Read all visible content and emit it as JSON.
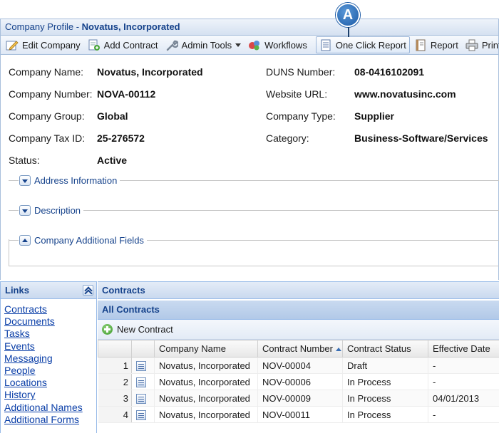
{
  "badge": "A",
  "title": {
    "prefix": "Company Profile - ",
    "company": "Novatus, Incorporated"
  },
  "toolbar": {
    "edit_company": "Edit Company",
    "add_contract": "Add Contract",
    "admin_tools": "Admin Tools",
    "workflows": "Workflows",
    "one_click_report": "One Click Report",
    "report": "Report",
    "print": "Print"
  },
  "profile": {
    "left": [
      {
        "label": "Company Name:",
        "value": "Novatus, Incorporated"
      },
      {
        "label": "Company Number:",
        "value": "NOVA-00112"
      },
      {
        "label": "Company Group:",
        "value": "Global"
      },
      {
        "label": "Company Tax ID:",
        "value": "25-276572"
      },
      {
        "label": "Status:",
        "value": "Active"
      }
    ],
    "right": [
      {
        "label": "DUNS Number:",
        "value": "08-0416102091"
      },
      {
        "label": "Website URL:",
        "value": "www.novatusinc.com"
      },
      {
        "label": "Company Type:",
        "value": "Supplier"
      },
      {
        "label": "Category:",
        "value": "Business-Software/Services"
      }
    ]
  },
  "sections": {
    "address": "Address Information",
    "description": "Description",
    "additional": "Company Additional Fields"
  },
  "links": {
    "title": "Links",
    "items": [
      "Contracts",
      "Documents",
      "Tasks",
      "Events",
      "Messaging",
      "People",
      "Locations",
      "History",
      "Additional Names",
      "Additional Forms"
    ]
  },
  "contracts": {
    "title": "Contracts",
    "subtitle": "All Contracts",
    "new_contract": "New Contract",
    "columns": [
      "Company Name",
      "Contract Number",
      "Contract Status",
      "Effective Date"
    ],
    "rows": [
      {
        "num": "1",
        "company": "Novatus, Incorporated",
        "number": "NOV-00004",
        "status": "Draft",
        "date": "-"
      },
      {
        "num": "2",
        "company": "Novatus, Incorporated",
        "number": "NOV-00006",
        "status": "In Process",
        "date": "-"
      },
      {
        "num": "3",
        "company": "Novatus, Incorporated",
        "number": "NOV-00009",
        "status": "In Process",
        "date": "04/01/2013"
      },
      {
        "num": "4",
        "company": "Novatus, Incorporated",
        "number": "NOV-00011",
        "status": "In Process",
        "date": "-"
      }
    ]
  }
}
